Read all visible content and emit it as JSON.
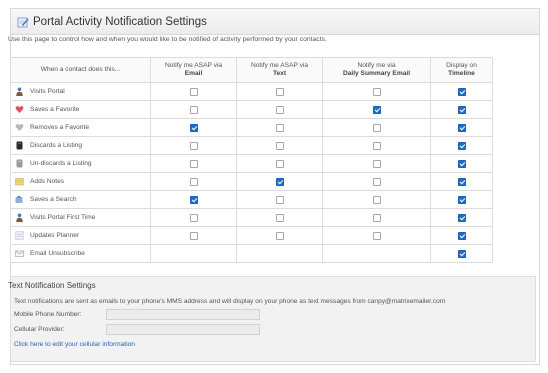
{
  "header": {
    "title": "Portal Activity Notification Settings",
    "icon": "edit-settings-icon"
  },
  "intro": "Use this page to control how and when you would like to be notified of activity performed by your contacts.",
  "columns": {
    "activity": "When a contact does this...",
    "email_top": "Notify me ASAP via",
    "email_bold": "Email",
    "text_top": "Notify me ASAP via",
    "text_bold": "Text",
    "summary_top": "Notify me via",
    "summary_bold": "Daily Summary Email",
    "timeline_top": "Display on",
    "timeline_bold": "Timeline"
  },
  "rows": [
    {
      "label": "Visits Portal",
      "icon": "person-icon",
      "email": false,
      "text": false,
      "summary": false,
      "timeline": true,
      "has_email": true,
      "has_text": true,
      "has_summary": true
    },
    {
      "label": "Saves a Favorite",
      "icon": "heart-icon",
      "email": false,
      "text": false,
      "summary": true,
      "timeline": true,
      "has_email": true,
      "has_text": true,
      "has_summary": true
    },
    {
      "label": "Removes a Favorite",
      "icon": "heart-gray-icon",
      "email": true,
      "text": false,
      "summary": false,
      "timeline": true,
      "has_email": true,
      "has_text": true,
      "has_summary": true
    },
    {
      "label": "Discards a Listing",
      "icon": "trash-icon",
      "email": false,
      "text": false,
      "summary": false,
      "timeline": true,
      "has_email": true,
      "has_text": true,
      "has_summary": true
    },
    {
      "label": "Un-discards a Listing",
      "icon": "trash-gray-icon",
      "email": false,
      "text": false,
      "summary": false,
      "timeline": true,
      "has_email": true,
      "has_text": true,
      "has_summary": true
    },
    {
      "label": "Adds Notes",
      "icon": "note-icon",
      "email": false,
      "text": true,
      "summary": false,
      "timeline": true,
      "has_email": true,
      "has_text": true,
      "has_summary": true
    },
    {
      "label": "Saves a Search",
      "icon": "search-save-icon",
      "email": true,
      "text": false,
      "summary": false,
      "timeline": true,
      "has_email": true,
      "has_text": true,
      "has_summary": true
    },
    {
      "label": "Visits Portal First Time",
      "icon": "person-icon",
      "email": false,
      "text": false,
      "summary": false,
      "timeline": true,
      "has_email": true,
      "has_text": true,
      "has_summary": true
    },
    {
      "label": "Updates Planner",
      "icon": "planner-icon",
      "email": false,
      "text": false,
      "summary": false,
      "timeline": true,
      "has_email": true,
      "has_text": true,
      "has_summary": true
    },
    {
      "label": "Email Unsubscribe",
      "icon": "email-icon",
      "email": false,
      "text": false,
      "summary": false,
      "timeline": true,
      "has_email": false,
      "has_text": false,
      "has_summary": false
    }
  ],
  "text_notifications": {
    "heading": "Text Notification Settings",
    "description": "Text notifications are sent as emails to your phone's MMS address and will display on your phone as text messages from canpy@matrixemailer.com",
    "phone_label": "Mobile Phone Number:",
    "phone_value": "",
    "provider_label": "Cellular Provider:",
    "provider_value": "",
    "edit_link": "Click here to edit your cellular information"
  },
  "colors": {
    "checked": "#1f6fd1",
    "link": "#2a62b8"
  }
}
